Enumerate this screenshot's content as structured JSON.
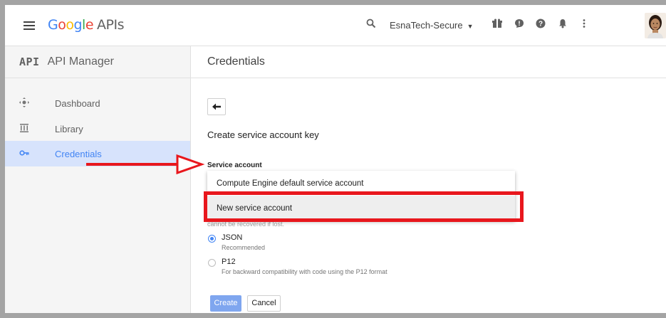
{
  "topbar": {
    "logo_letters": [
      "G",
      "o",
      "o",
      "g",
      "l",
      "e"
    ],
    "logo_suffix": "APIs",
    "project_name": "EsnaTech-Secure",
    "icons": [
      "menu-icon",
      "search-icon",
      "gift-icon",
      "chat-icon",
      "help-icon",
      "bell-icon",
      "more-vert-icon"
    ]
  },
  "sidebar": {
    "badge": "API",
    "title": "API Manager",
    "items": [
      {
        "label": "Dashboard",
        "icon": "dashboard-icon",
        "active": false
      },
      {
        "label": "Library",
        "icon": "library-icon",
        "active": false
      },
      {
        "label": "Credentials",
        "icon": "key-icon",
        "active": true
      }
    ]
  },
  "main": {
    "title": "Credentials",
    "back_icon": "arrow-back-icon",
    "subtitle": "Create service account key",
    "service_account_label": "Service account",
    "dropdown_options": [
      "Compute Engine default service account",
      "New service account"
    ],
    "selected_option_index": 1,
    "hint_text": "cannot be recovered if lost.",
    "key_types": [
      {
        "label": "JSON",
        "description": "Recommended",
        "checked": true
      },
      {
        "label": "P12",
        "description": "For backward compatibility with code using the P12 format",
        "checked": false
      }
    ],
    "create_label": "Create",
    "cancel_label": "Cancel"
  },
  "colors": {
    "accent": "#4285f4",
    "annotation_red": "#e8171d",
    "active_nav_bg": "#d7e3fc"
  }
}
